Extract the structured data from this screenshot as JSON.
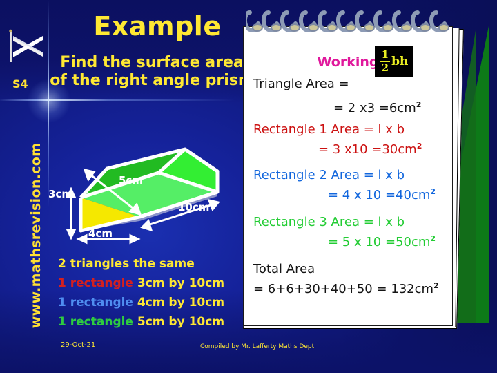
{
  "slide": {
    "title": "Example",
    "subtitle": "Find the surface area of the right angle prism",
    "level_label": "S4",
    "site_url": "www.mathsrevision.com",
    "flag_icon": "scotland-saltire-flag-icon"
  },
  "diagram": {
    "labels": {
      "height": "3cm",
      "base": "4cm",
      "hypotenuse": "5cm",
      "length": "10cm"
    },
    "colors": {
      "triangle_face": "#f5e800",
      "top_face": "#22bb22",
      "end_face": "#33ee33",
      "inner_face": "#55ee66",
      "outline": "#ffffff"
    }
  },
  "bullets": [
    {
      "prefix": "",
      "prefix_color": "yellow",
      "text": "2 triangles the same"
    },
    {
      "prefix": "1 rectangle",
      "prefix_color": "red",
      "text": "3cm by 10cm"
    },
    {
      "prefix": "1 rectangle",
      "prefix_color": "blue",
      "text": "4cm by 10cm"
    },
    {
      "prefix": "1 rectangle",
      "prefix_color": "green",
      "text": "5cm by 10cm"
    }
  ],
  "working": {
    "heading": "Working",
    "triangle_label": "Triangle Area =",
    "formula_numerator": "1",
    "formula_denominator": "2",
    "formula_tail": "bh",
    "triangle_result": "= 2 x3 =6cm",
    "rect1_label": "Rectangle 1 Area = l x b",
    "rect1_result": "= 3 x10 =30cm",
    "rect2_label": "Rectangle 2 Area = l x b",
    "rect2_result": "= 4 x 10 =40cm",
    "rect3_label": "Rectangle 3 Area = l x b",
    "rect3_result": "= 5 x 10 =50cm",
    "total_label": "Total Area",
    "total_result": "= 6+6+30+40+50 = 132cm",
    "squared": "2",
    "colors": {
      "heading": "#e0189c",
      "rect1": "#cc1111",
      "rect2": "#1166dd",
      "rect3": "#22cc33",
      "black": "#141414"
    }
  },
  "footer": {
    "date": "29-Oct-21",
    "credit": "Compiled by Mr. Lafferty Maths Dept."
  }
}
